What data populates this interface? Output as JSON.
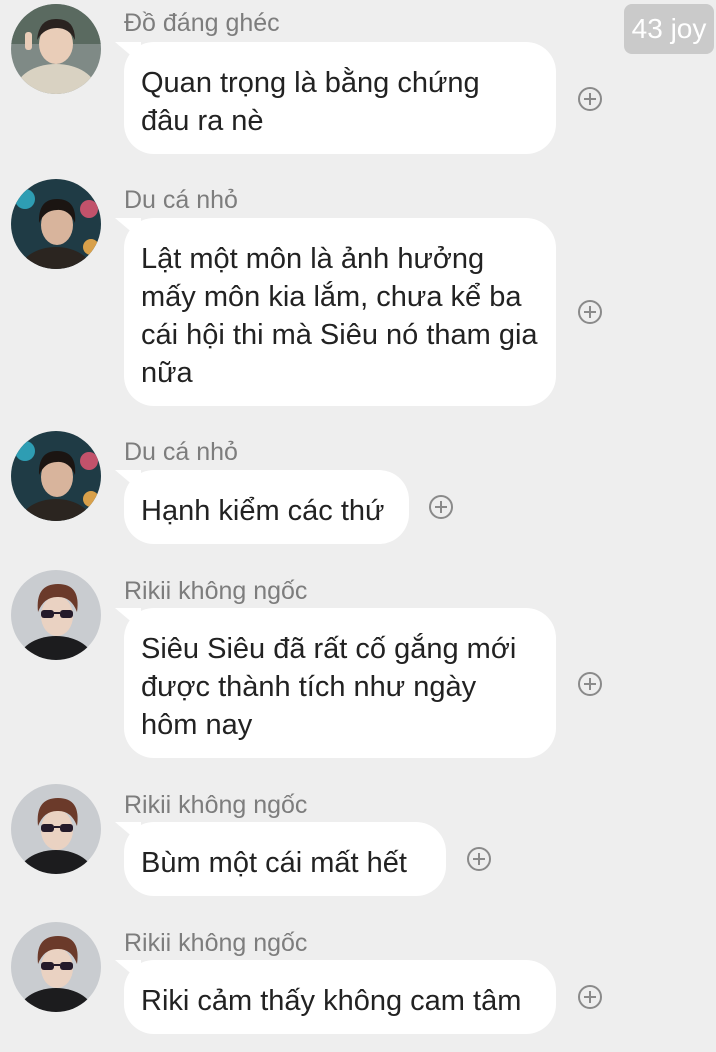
{
  "watermark": {
    "text": "43 joy"
  },
  "colors": {
    "background": "#eeeeee",
    "bubble": "#ffffff",
    "sender_text": "#7d7d7d",
    "message_text": "#222222"
  },
  "messages": [
    {
      "sender": "Đồ đáng ghéc",
      "avatar": "avatar-icon",
      "text": "Quan trọng là bằng chứng\nđâu ra nè"
    },
    {
      "sender": "Du cá nhỏ",
      "avatar": "avatar-icon",
      "text": "Lật một môn là ảnh hưởng\nmấy môn kia lắm, chưa kể ba\ncái hội thi mà Siêu nó tham gia\nnữa"
    },
    {
      "sender": "Du cá nhỏ",
      "avatar": "avatar-icon",
      "text": "Hạnh kiểm các thứ"
    },
    {
      "sender": "Rikii không ngốc",
      "avatar": "avatar-icon",
      "text": "Siêu Siêu đã rất cố gắng mới\nđược thành tích như ngày\nhôm nay"
    },
    {
      "sender": "Rikii không ngốc",
      "avatar": "avatar-icon",
      "text": "Bùm một cái mất hết"
    },
    {
      "sender": "Rikii không ngốc",
      "avatar": "avatar-icon",
      "text": "Riki cảm thấy không cam tâm"
    }
  ]
}
